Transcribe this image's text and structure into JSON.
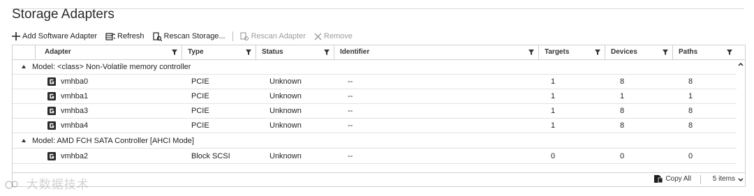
{
  "page": {
    "title": "Storage Adapters"
  },
  "toolbar": {
    "add_label": "Add Software Adapter",
    "refresh_label": "Refresh",
    "rescan_storage_label": "Rescan Storage...",
    "rescan_adapter_label": "Rescan Adapter",
    "remove_label": "Remove"
  },
  "columns": {
    "adapter": "Adapter",
    "type": "Type",
    "status": "Status",
    "identifier": "Identifier",
    "targets": "Targets",
    "devices": "Devices",
    "paths": "Paths"
  },
  "groups": [
    {
      "label": "Model: <class> Non-Volatile memory controller",
      "rows": [
        {
          "adapter": "vmhba0",
          "type": "PCIE",
          "status": "Unknown",
          "identifier": "--",
          "targets": "1",
          "devices": "8",
          "paths": "8"
        },
        {
          "adapter": "vmhba1",
          "type": "PCIE",
          "status": "Unknown",
          "identifier": "--",
          "targets": "1",
          "devices": "1",
          "paths": "1"
        },
        {
          "adapter": "vmhba3",
          "type": "PCIE",
          "status": "Unknown",
          "identifier": "--",
          "targets": "1",
          "devices": "8",
          "paths": "8"
        },
        {
          "adapter": "vmhba4",
          "type": "PCIE",
          "status": "Unknown",
          "identifier": "--",
          "targets": "1",
          "devices": "8",
          "paths": "8"
        }
      ]
    },
    {
      "label": "Model: AMD FCH SATA Controller [AHCI Mode]",
      "rows": [
        {
          "adapter": "vmhba2",
          "type": "Block SCSI",
          "status": "Unknown",
          "identifier": "--",
          "targets": "0",
          "devices": "0",
          "paths": "0"
        }
      ]
    }
  ],
  "footer": {
    "copy_all": "Copy All",
    "items": "5 items"
  },
  "watermark": "大数据技术"
}
